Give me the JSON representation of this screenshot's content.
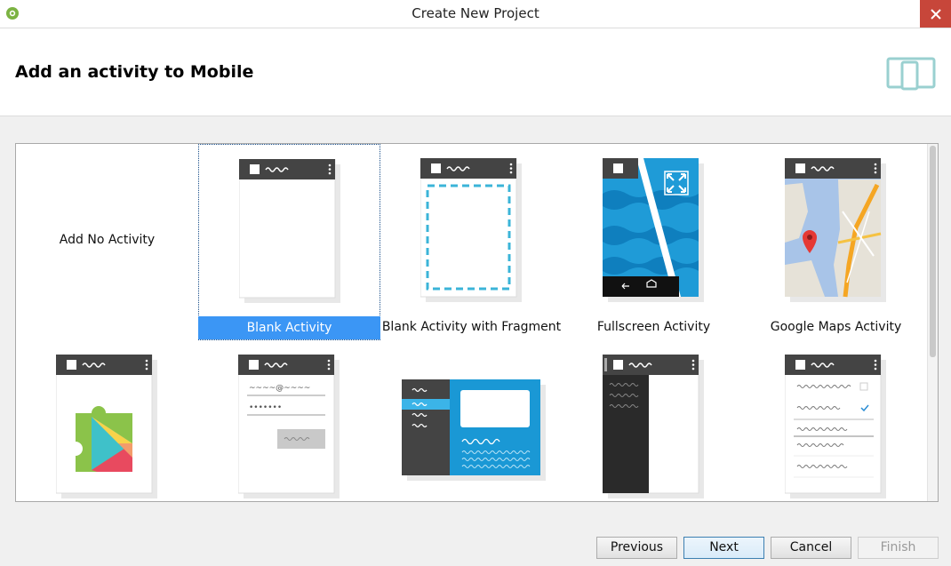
{
  "window": {
    "title": "Create New Project"
  },
  "header": {
    "heading": "Add an activity to Mobile"
  },
  "gallery": {
    "tiles": [
      {
        "label": "Add No Activity"
      },
      {
        "label": "Blank Activity",
        "selected": true
      },
      {
        "label": "Blank Activity with Fragment"
      },
      {
        "label": "Fullscreen Activity"
      },
      {
        "label": "Google Maps Activity"
      },
      {
        "label": ""
      },
      {
        "label": ""
      },
      {
        "label": ""
      },
      {
        "label": ""
      },
      {
        "label": ""
      }
    ]
  },
  "login_thumb": {
    "email_hint": "~~~~@~~~~",
    "password_hint": "•••••••"
  },
  "buttons": {
    "previous": "Previous",
    "next": "Next",
    "cancel": "Cancel",
    "finish": "Finish"
  },
  "colors": {
    "accent": "#3b96f5",
    "close": "#c7463a",
    "thumb_bar": "#444444",
    "android_green": "#8bc34a"
  },
  "icons": {
    "app": "android-studio-icon",
    "close": "close-icon",
    "devices": "phone-tablet-icon"
  }
}
